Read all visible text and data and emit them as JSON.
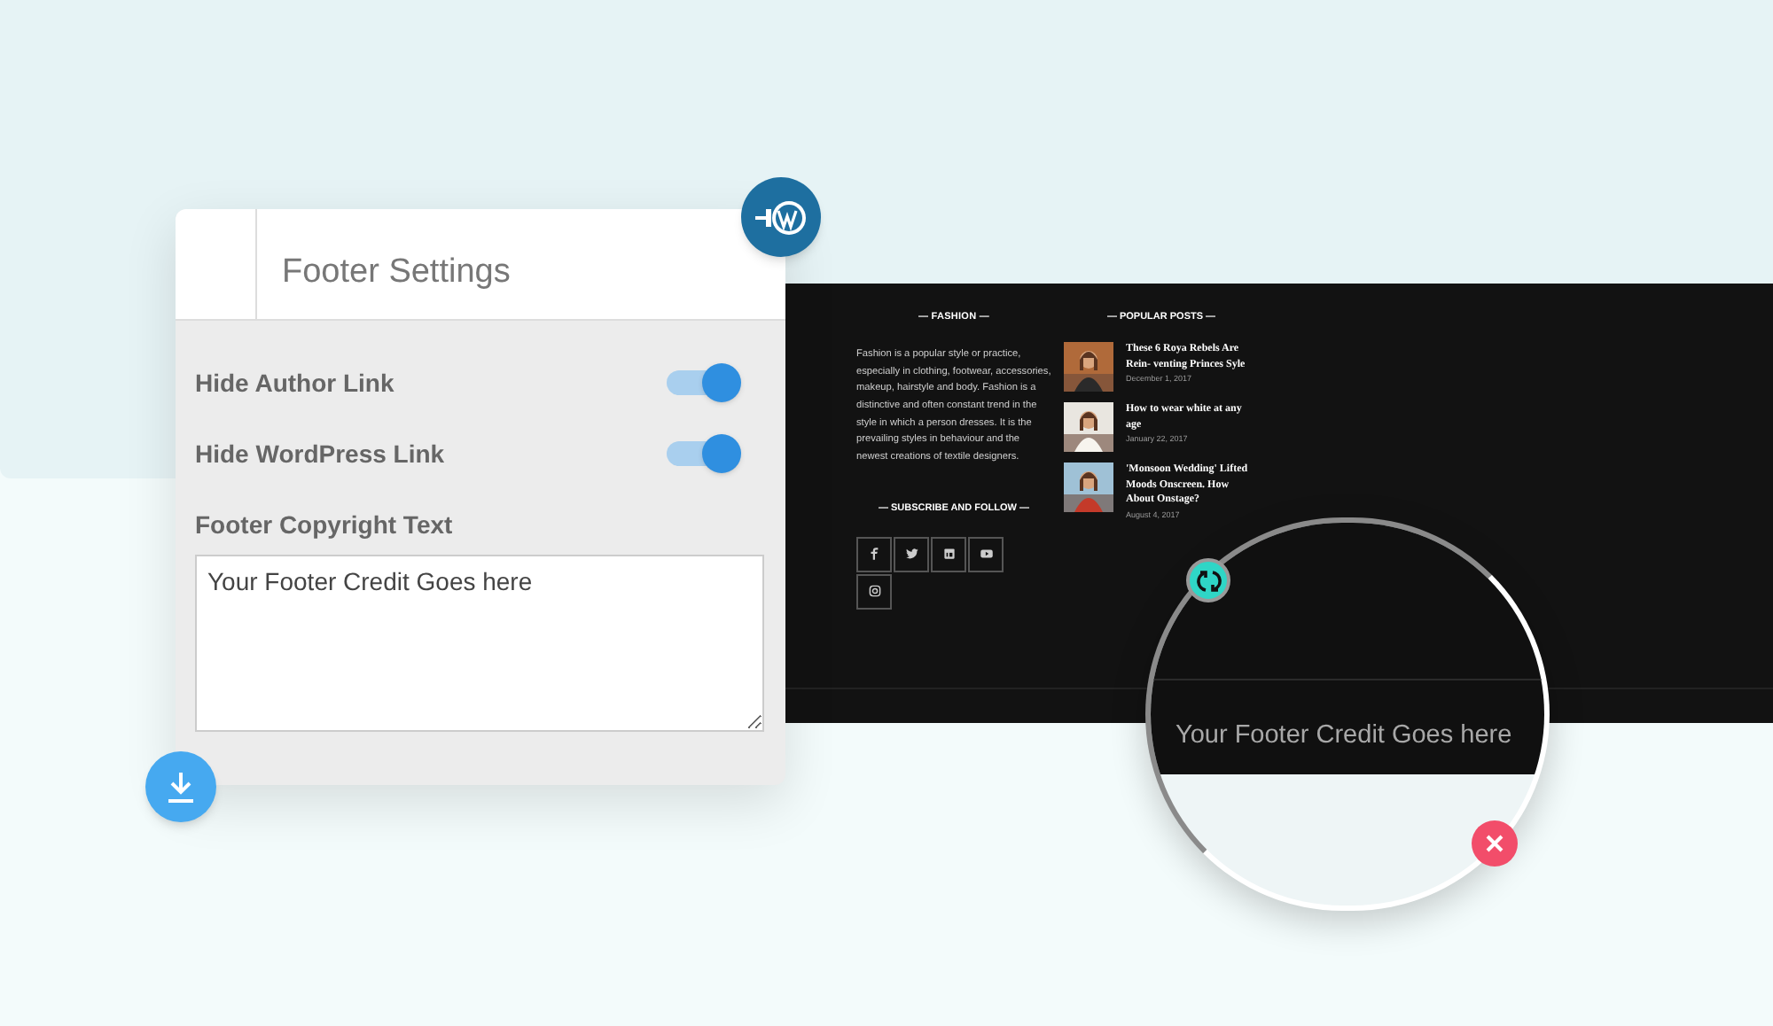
{
  "settings_panel": {
    "title": "Footer Settings",
    "toggles": [
      {
        "label": "Hide Author Link",
        "on": true
      },
      {
        "label": "Hide WordPress Link",
        "on": true
      }
    ],
    "copyright": {
      "label": "Footer Copyright Text",
      "value": "Your Footer Credit Goes here"
    }
  },
  "footer_preview": {
    "fashion": {
      "heading": "— FASHION —",
      "text": "Fashion is a popular style or practice, especially in clothing, footwear, accessories, makeup, hairstyle and body. Fashion is a distinctive and often constant trend in the style in which a person dresses. It is the prevailing styles in behaviour and the newest creations of textile designers."
    },
    "subscribe": {
      "heading": "— SUBSCRIBE AND FOLLOW —",
      "icons": [
        {
          "kind": "facebook"
        },
        {
          "kind": "twitter"
        },
        {
          "kind": "linkedin"
        },
        {
          "kind": "youtube"
        },
        {
          "kind": "instagram"
        }
      ]
    },
    "popular_posts": {
      "heading": "— POPULAR POSTS —",
      "posts": [
        {
          "title": "These 6 Roya Rebels Are Rein- venting Princes Syle",
          "date": "December 1, 2017"
        },
        {
          "title": "How to wear white at any age",
          "date": "January 22, 2017"
        },
        {
          "title": "'Monsoon Wedding' Lifted Moods Onscreen. How About Onstage?",
          "date": "August 4, 2017"
        }
      ]
    }
  },
  "magnifier": {
    "credit_text": "Your Footer Credit Goes here"
  }
}
